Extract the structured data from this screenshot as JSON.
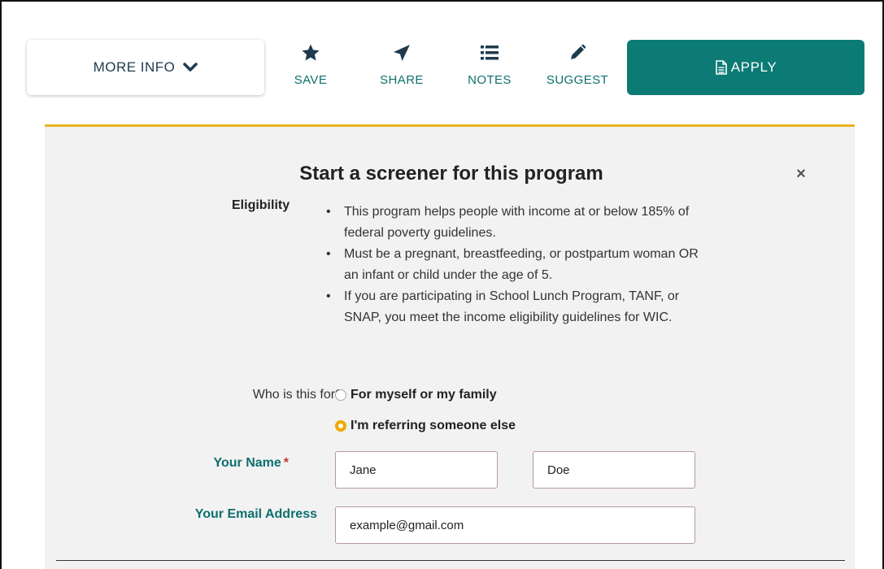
{
  "toolbar": {
    "more_info_label": "MORE INFO",
    "save_label": "SAVE",
    "share_label": "SHARE",
    "notes_label": "NOTES",
    "suggest_label": "SUGGEST",
    "apply_label": "APPLY"
  },
  "screener": {
    "title": "Start a screener for this program",
    "close_icon": "×",
    "eligibility_label": "Eligibility",
    "eligibility_items": [
      "This program helps people with income at or below 185% of federal poverty guidelines.",
      "Must be a pregnant, breastfeeding, or postpartum woman OR an infant or child under the age of 5.",
      "If you are participating in School Lunch Program, TANF, or SNAP, you meet the income eligibility guidelines for WIC."
    ],
    "who_label": "Who is this for?",
    "options": [
      {
        "label": "For myself or my family",
        "selected": false
      },
      {
        "label": "I'm referring someone else",
        "selected": true
      }
    ],
    "name_label": "Your Name",
    "required_mark": "*",
    "first_name_value": "Jane",
    "last_name_value": "Doe",
    "email_label": "Your Email Address",
    "email_value": "example@gmail.com"
  },
  "colors": {
    "teal": "#0c7b75",
    "accent_yellow": "#e8b321",
    "required_red": "#c0392b"
  }
}
